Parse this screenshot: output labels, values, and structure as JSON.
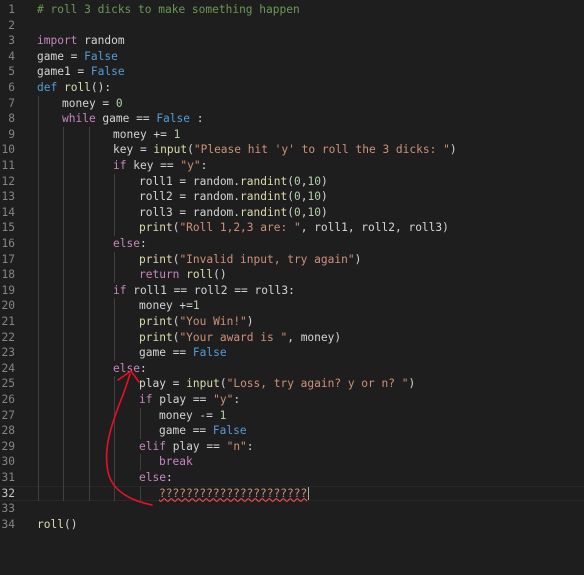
{
  "editor": {
    "lines": [
      {
        "n": "1",
        "indent": 0,
        "tokens": [
          [
            "comment",
            "# roll 3 dicks to make something happen"
          ]
        ]
      },
      {
        "n": "2",
        "indent": 0,
        "tokens": []
      },
      {
        "n": "3",
        "indent": 0,
        "tokens": [
          [
            "keyword",
            "import"
          ],
          [
            "plain",
            " random"
          ]
        ]
      },
      {
        "n": "4",
        "indent": 0,
        "tokens": [
          [
            "plain",
            "game = "
          ],
          [
            "const",
            "False"
          ]
        ]
      },
      {
        "n": "5",
        "indent": 0,
        "tokens": [
          [
            "plain",
            "game1 = "
          ],
          [
            "const",
            "False"
          ]
        ]
      },
      {
        "n": "6",
        "indent": 0,
        "tokens": [
          [
            "storage",
            "def"
          ],
          [
            "plain",
            " "
          ],
          [
            "func",
            "roll"
          ],
          [
            "plain",
            "():"
          ]
        ]
      },
      {
        "n": "7",
        "indent": 1,
        "tokens": [
          [
            "plain",
            "money = "
          ],
          [
            "number",
            "0"
          ]
        ]
      },
      {
        "n": "8",
        "indent": 1,
        "tokens": [
          [
            "keyword",
            "while"
          ],
          [
            "plain",
            " game == "
          ],
          [
            "const",
            "False"
          ],
          [
            "plain",
            " :"
          ]
        ]
      },
      {
        "n": "9",
        "indent": 3,
        "tokens": [
          [
            "plain",
            "money += "
          ],
          [
            "number",
            "1"
          ]
        ]
      },
      {
        "n": "10",
        "indent": 3,
        "tokens": [
          [
            "plain",
            "key = "
          ],
          [
            "func",
            "input"
          ],
          [
            "plain",
            "("
          ],
          [
            "string",
            "\"Please hit 'y' to roll the 3 dicks: \""
          ],
          [
            "plain",
            ")"
          ]
        ]
      },
      {
        "n": "11",
        "indent": 3,
        "tokens": [
          [
            "keyword",
            "if"
          ],
          [
            "plain",
            " key == "
          ],
          [
            "string",
            "\"y\""
          ],
          [
            "plain",
            ":"
          ]
        ]
      },
      {
        "n": "12",
        "indent": 4,
        "tokens": [
          [
            "plain",
            "roll1 = random."
          ],
          [
            "func",
            "randint"
          ],
          [
            "plain",
            "("
          ],
          [
            "number",
            "0"
          ],
          [
            "plain",
            ","
          ],
          [
            "number",
            "10"
          ],
          [
            "plain",
            ")"
          ]
        ]
      },
      {
        "n": "13",
        "indent": 4,
        "tokens": [
          [
            "plain",
            "roll2 = random."
          ],
          [
            "func",
            "randint"
          ],
          [
            "plain",
            "("
          ],
          [
            "number",
            "0"
          ],
          [
            "plain",
            ","
          ],
          [
            "number",
            "10"
          ],
          [
            "plain",
            ")"
          ]
        ]
      },
      {
        "n": "14",
        "indent": 4,
        "tokens": [
          [
            "plain",
            "roll3 = random."
          ],
          [
            "func",
            "randint"
          ],
          [
            "plain",
            "("
          ],
          [
            "number",
            "0"
          ],
          [
            "plain",
            ","
          ],
          [
            "number",
            "10"
          ],
          [
            "plain",
            ")"
          ]
        ]
      },
      {
        "n": "15",
        "indent": 4,
        "tokens": [
          [
            "func",
            "print"
          ],
          [
            "plain",
            "("
          ],
          [
            "string",
            "\"Roll 1,2,3 are: \""
          ],
          [
            "plain",
            ", roll1, roll2, roll3)"
          ]
        ]
      },
      {
        "n": "16",
        "indent": 3,
        "tokens": [
          [
            "keyword",
            "else"
          ],
          [
            "plain",
            ":"
          ]
        ]
      },
      {
        "n": "17",
        "indent": 4,
        "tokens": [
          [
            "func",
            "print"
          ],
          [
            "plain",
            "("
          ],
          [
            "string",
            "\"Invalid input, try again\""
          ],
          [
            "plain",
            ")"
          ]
        ]
      },
      {
        "n": "18",
        "indent": 4,
        "tokens": [
          [
            "keyword",
            "return"
          ],
          [
            "plain",
            " "
          ],
          [
            "func",
            "roll"
          ],
          [
            "plain",
            "()"
          ]
        ]
      },
      {
        "n": "19",
        "indent": 3,
        "tokens": [
          [
            "keyword",
            "if"
          ],
          [
            "plain",
            " roll1 == roll2 == roll3:"
          ]
        ]
      },
      {
        "n": "20",
        "indent": 4,
        "tokens": [
          [
            "plain",
            "money +="
          ],
          [
            "number",
            "1"
          ]
        ]
      },
      {
        "n": "21",
        "indent": 4,
        "tokens": [
          [
            "func",
            "print"
          ],
          [
            "plain",
            "("
          ],
          [
            "string",
            "\"You Win!\""
          ],
          [
            "plain",
            ")"
          ]
        ]
      },
      {
        "n": "22",
        "indent": 4,
        "tokens": [
          [
            "func",
            "print"
          ],
          [
            "plain",
            "("
          ],
          [
            "string",
            "\"Your award is \""
          ],
          [
            "plain",
            ", money)"
          ]
        ]
      },
      {
        "n": "23",
        "indent": 4,
        "tokens": [
          [
            "plain",
            "game == "
          ],
          [
            "const",
            "False"
          ]
        ]
      },
      {
        "n": "24",
        "indent": 3,
        "tokens": [
          [
            "keyword",
            "else"
          ],
          [
            "plain",
            ":"
          ]
        ]
      },
      {
        "n": "25",
        "indent": 4,
        "tokens": [
          [
            "plain",
            "play = "
          ],
          [
            "func",
            "input"
          ],
          [
            "plain",
            "("
          ],
          [
            "string",
            "\"Loss, try again? y or n? \""
          ],
          [
            "plain",
            ")"
          ]
        ]
      },
      {
        "n": "26",
        "indent": 4,
        "tokens": [
          [
            "keyword",
            "if"
          ],
          [
            "plain",
            " play == "
          ],
          [
            "string",
            "\"y\""
          ],
          [
            "plain",
            ":"
          ]
        ]
      },
      {
        "n": "27",
        "indent": 5,
        "tokens": [
          [
            "plain",
            "money -= "
          ],
          [
            "number",
            "1"
          ]
        ]
      },
      {
        "n": "28",
        "indent": 5,
        "tokens": [
          [
            "plain",
            "game == "
          ],
          [
            "const",
            "False"
          ]
        ]
      },
      {
        "n": "29",
        "indent": 4,
        "tokens": [
          [
            "keyword",
            "elif"
          ],
          [
            "plain",
            " play == "
          ],
          [
            "string",
            "\"n\""
          ],
          [
            "plain",
            ":"
          ]
        ]
      },
      {
        "n": "30",
        "indent": 5,
        "tokens": [
          [
            "keyword",
            "break"
          ]
        ]
      },
      {
        "n": "31",
        "indent": 4,
        "tokens": [
          [
            "keyword",
            "else"
          ],
          [
            "plain",
            ":"
          ]
        ]
      },
      {
        "n": "32",
        "indent": 5,
        "current": true,
        "tokens": [
          [
            "squiggle",
            "??????????????????????"
          ]
        ]
      },
      {
        "n": "33",
        "indent": 0,
        "tokens": []
      },
      {
        "n": "34",
        "indent": 0,
        "tokens": [
          [
            "func",
            "roll"
          ],
          [
            "plain",
            "()"
          ]
        ]
      }
    ]
  },
  "colors": {
    "background": "#1e1e1e",
    "annotation": "#e81123"
  }
}
